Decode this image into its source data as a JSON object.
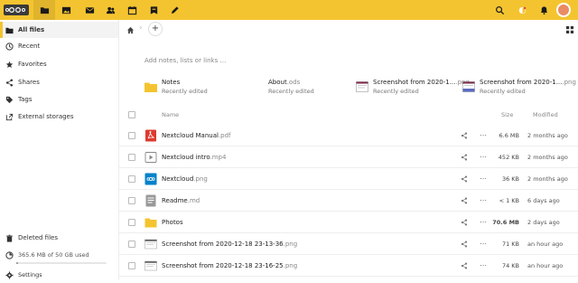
{
  "header": {
    "logo_alt": "Nextcloud",
    "apps": [
      {
        "name": "files-icon"
      },
      {
        "name": "photos-icon"
      },
      {
        "name": "mail-icon"
      },
      {
        "name": "contacts-icon"
      },
      {
        "name": "calendar-icon"
      },
      {
        "name": "deck-icon"
      },
      {
        "name": "notes-icon"
      }
    ],
    "accent": "#f4c430"
  },
  "sidebar": {
    "items": [
      {
        "label": "All files",
        "icon": "folder-icon"
      },
      {
        "label": "Recent",
        "icon": "clock-icon"
      },
      {
        "label": "Favorites",
        "icon": "star-icon"
      },
      {
        "label": "Shares",
        "icon": "share-icon"
      },
      {
        "label": "Tags",
        "icon": "tag-icon"
      },
      {
        "label": "External storages",
        "icon": "external-icon"
      }
    ],
    "deleted_label": "Deleted files",
    "quota_label": "365.6 MB of 50 GB used",
    "quota_fraction": 0.007,
    "settings_label": "Settings"
  },
  "main": {
    "description_placeholder": "Add notes, lists or links …",
    "recent": [
      {
        "name": "Notes",
        "ext": "",
        "sub": "Recently edited"
      },
      {
        "name": "About",
        "ext": ".ods",
        "sub": "Recently edited"
      },
      {
        "name": "Screenshot from 2020-1...",
        "ext": ".png",
        "sub": "Recently edited"
      },
      {
        "name": "Screenshot from 2020-1...",
        "ext": ".png",
        "sub": "Recently edited"
      }
    ],
    "columns": {
      "name": "Name",
      "size": "Size",
      "modified": "Modified"
    },
    "files": [
      {
        "name": "Nextcloud Manual",
        "ext": ".pdf",
        "size": "6.6 MB",
        "modified": "2 months ago",
        "icon": "pdf-icon"
      },
      {
        "name": "Nextcloud intro",
        "ext": ".mp4",
        "size": "452 KB",
        "modified": "2 months ago",
        "icon": "video-icon"
      },
      {
        "name": "Nextcloud",
        "ext": ".png",
        "size": "36 KB",
        "modified": "2 months ago",
        "icon": "nextcloud-image-icon"
      },
      {
        "name": "Readme",
        "ext": ".md",
        "size": "< 1 KB",
        "modified": "6 days ago",
        "icon": "text-file-icon"
      },
      {
        "name": "Photos",
        "ext": "",
        "size": "70.6 MB",
        "modified": "2 days ago",
        "icon": "folder-icon"
      },
      {
        "name": "Screenshot from 2020-12-18 23-13-36",
        "ext": ".png",
        "size": "71 KB",
        "modified": "an hour ago",
        "icon": "screenshot-thumb-icon"
      },
      {
        "name": "Screenshot from 2020-12-18 23-16-25",
        "ext": ".png",
        "size": "74 KB",
        "modified": "an hour ago",
        "icon": "screenshot-thumb-icon"
      }
    ]
  }
}
